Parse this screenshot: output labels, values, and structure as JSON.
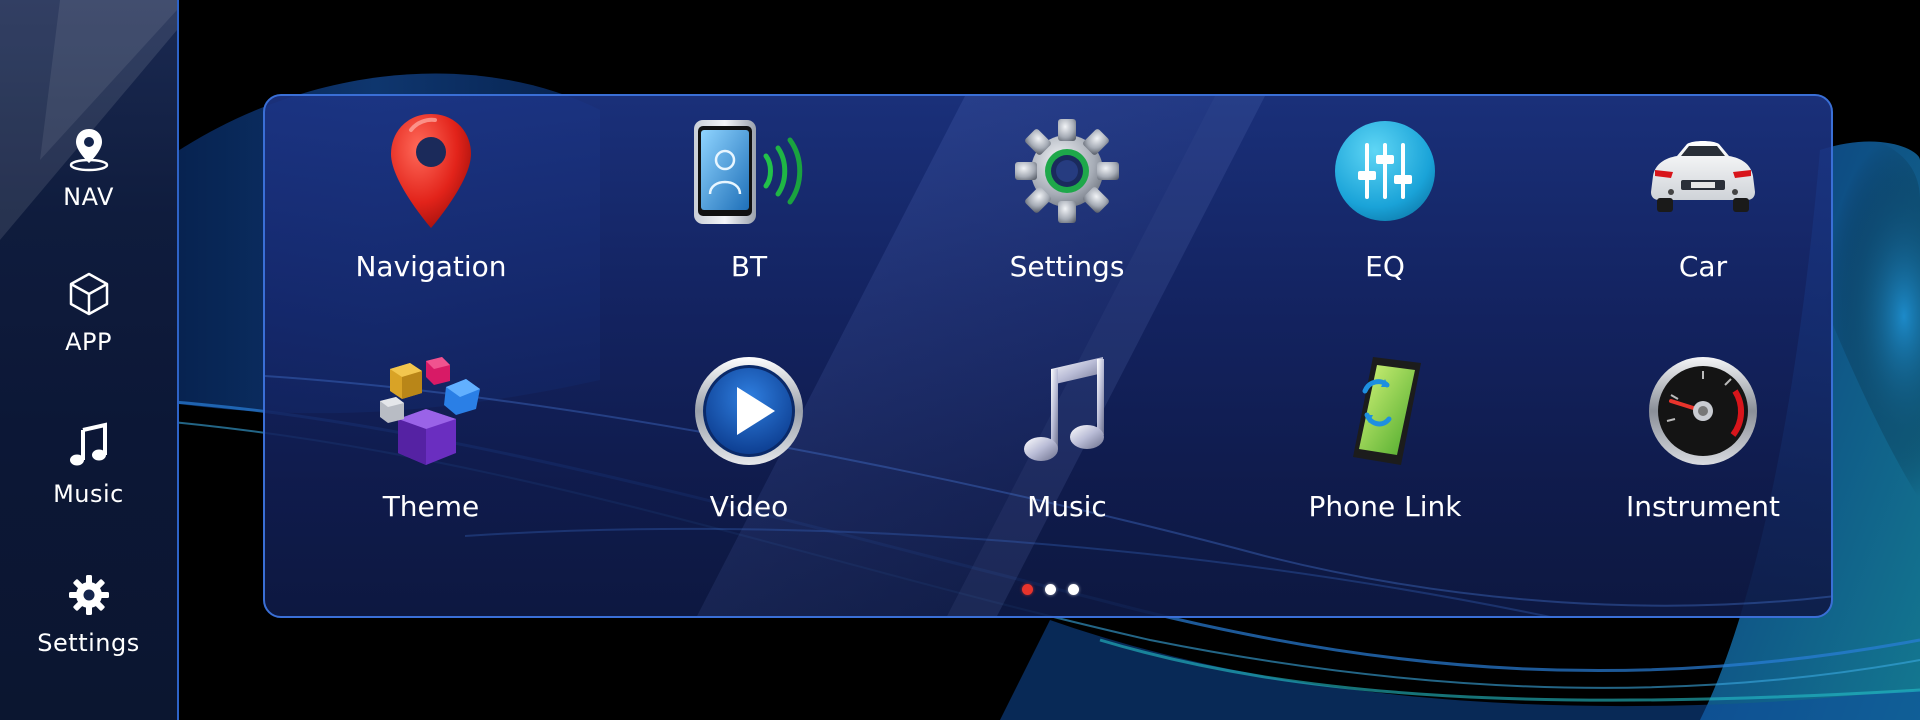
{
  "sidebar": {
    "items": [
      {
        "label": "NAV",
        "icon": "map-pin-icon"
      },
      {
        "label": "APP",
        "icon": "cube-icon"
      },
      {
        "label": "Music",
        "icon": "music-note-icon"
      },
      {
        "label": "Settings",
        "icon": "gear-icon"
      }
    ]
  },
  "apps": [
    {
      "label": "Navigation",
      "icon": "red-map-pin-icon"
    },
    {
      "label": "BT",
      "icon": "bluetooth-phone-icon"
    },
    {
      "label": "Settings",
      "icon": "gear-icon"
    },
    {
      "label": "EQ",
      "icon": "equalizer-icon"
    },
    {
      "label": "Car",
      "icon": "car-icon"
    },
    {
      "label": "Theme",
      "icon": "cubes-icon"
    },
    {
      "label": "Video",
      "icon": "play-icon"
    },
    {
      "label": "Music",
      "icon": "music-note-icon"
    },
    {
      "label": "Phone Link",
      "icon": "phone-link-icon"
    },
    {
      "label": "Instrument",
      "icon": "gauge-icon"
    }
  ],
  "pagination": {
    "total_pages": 3,
    "current_page": 1
  },
  "colors": {
    "accent_border": "#3a6fd6",
    "active_dot": "#e8342c",
    "text": "#ffffff"
  }
}
